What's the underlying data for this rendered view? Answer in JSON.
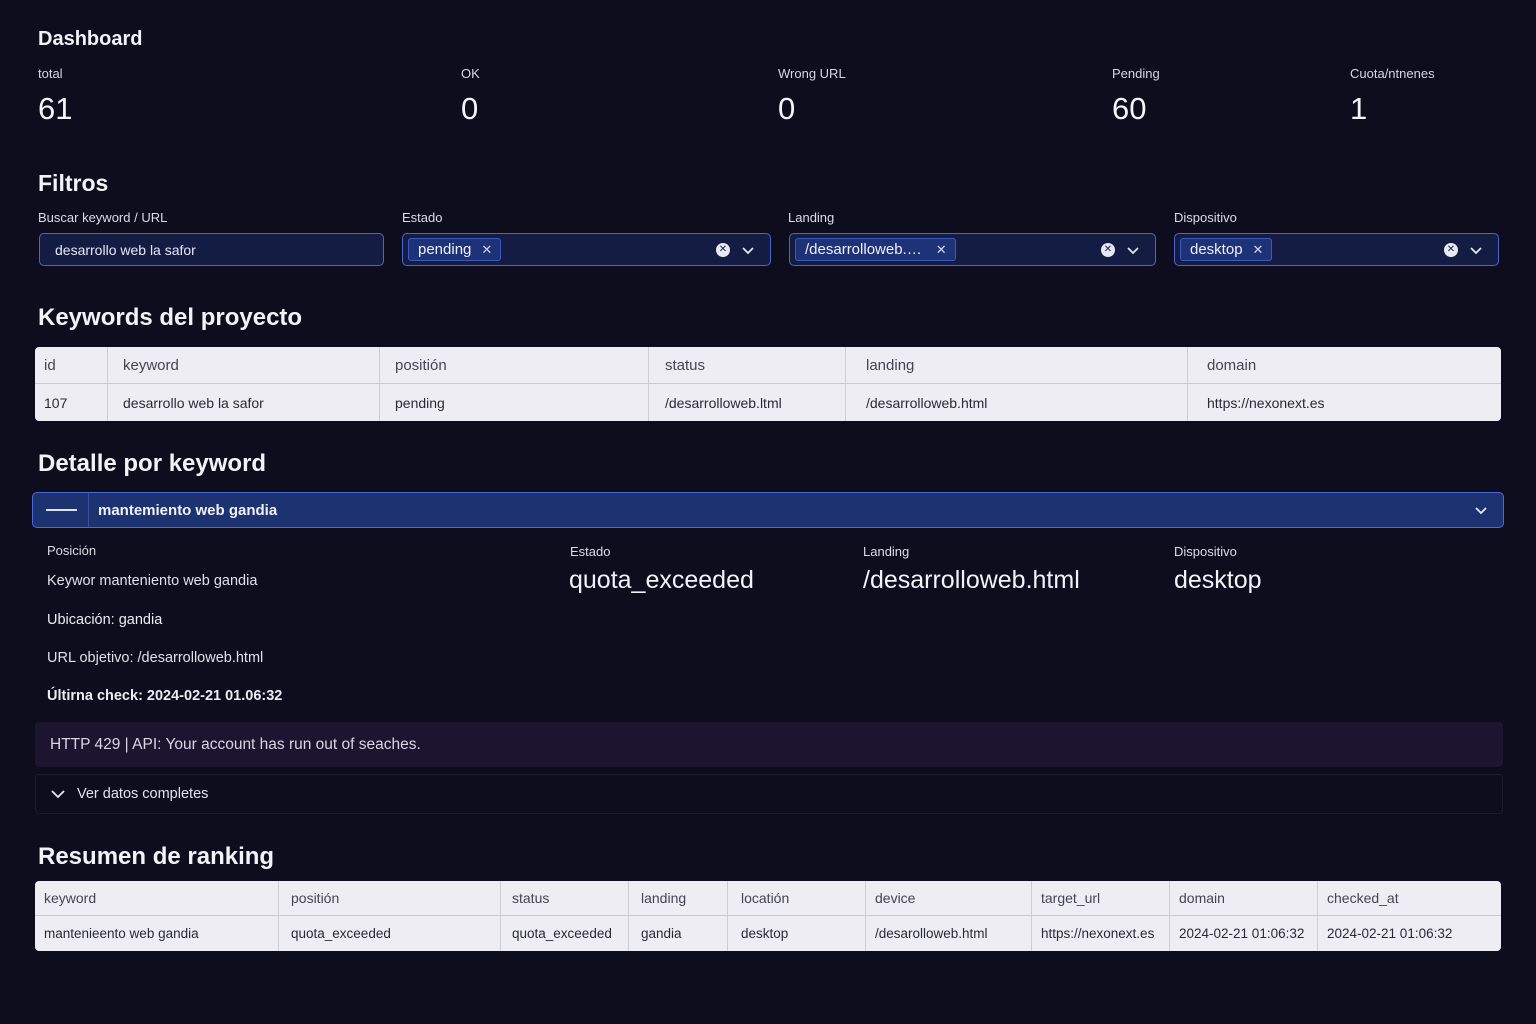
{
  "dashboard": {
    "title": "Dashboard",
    "metrics": [
      {
        "label": "total",
        "value": "61"
      },
      {
        "label": "OK",
        "value": "0"
      },
      {
        "label": "Wrong URL",
        "value": "0"
      },
      {
        "label": "Pending",
        "value": "60"
      },
      {
        "label": "Cuota/ntnenes",
        "value": "1"
      }
    ]
  },
  "filters": {
    "title": "Filtros",
    "search": {
      "label": "Buscar keyword / URL",
      "value": "desarrollo web la safor"
    },
    "estado": {
      "label": "Estado",
      "chip": "pending"
    },
    "landing": {
      "label": "Landing",
      "chip": "/desarrolloweb.…"
    },
    "dispositivo": {
      "label": "Dispositivo",
      "chip": "desktop"
    }
  },
  "keywords": {
    "title": "Keywords del proyecto",
    "columns": [
      "id",
      "keyword",
      "positión",
      "status",
      "landing",
      "domain"
    ],
    "rows": [
      [
        "107",
        "desarrollo web la safor",
        "pending",
        "/desarrolloweb.ltml",
        "/desarrolloweb.html",
        "https://nexonext.es"
      ]
    ]
  },
  "detail": {
    "title": "Detalle por keyword",
    "accordion_title": "mantemiento web gandia",
    "posicion_label": "Posición",
    "keyword_line": "Keywor manteniento web gandia",
    "ubicacion_line": "Ubicación: gandia",
    "url_line": "URL objetivo: /desarrolloweb.html",
    "check_line": "Últirna check: 2024-02-21 01.06:32",
    "estado_label": "Estado",
    "estado_value": "quota_exceeded",
    "landing_label": "Landing",
    "landing_value": "/desarrolloweb.html",
    "dispositivo_label": "Dispositivo",
    "dispositivo_value": "desktop",
    "alert": "HTTP 429 | API: Your account has run out of seaches.",
    "expander": "Ver datos completes"
  },
  "summary": {
    "title": "Resumen de ranking",
    "columns": [
      "keyword",
      "positión",
      "status",
      "landing",
      "locatión",
      "device",
      "target_url",
      "domain",
      "checked_at"
    ],
    "rows": [
      [
        "mantenieento web gandia",
        "quota_exceeded",
        "quota_exceeded",
        "gandia",
        "desktop",
        "/desarolloweb.html",
        "https://nexonext.es",
        "2024-02-21 01:06:32",
        "2024-02-21 01:06:32"
      ]
    ]
  }
}
